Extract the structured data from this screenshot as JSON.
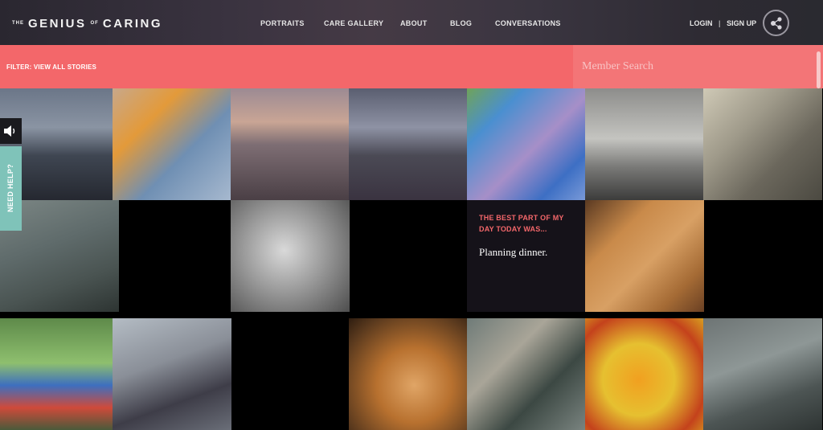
{
  "header": {
    "logo": {
      "word1": "THE",
      "word2": "GENIUS",
      "word3": "OF",
      "word4": "CARING"
    },
    "nav": [
      "PORTRAITS",
      "CARE GALLERY",
      "ABOUT",
      "BLOG",
      "CONVERSATIONS"
    ],
    "login": "LOGIN",
    "separator": "|",
    "signup": "SIGN UP",
    "share_icon": "share-icon"
  },
  "filter": {
    "label": "FILTER: VIEW ALL STORIES"
  },
  "search": {
    "placeholder": "Member Search"
  },
  "quote": {
    "heading": "THE BEST PART OF MY DAY TODAY WAS...",
    "text": "Planning dinner."
  },
  "side": {
    "help": "NEED HELP?",
    "sound_icon": "speaker-icon"
  },
  "colors": {
    "accent": "#f3676a",
    "help": "#7fc3b9",
    "header": "#2a2730"
  }
}
